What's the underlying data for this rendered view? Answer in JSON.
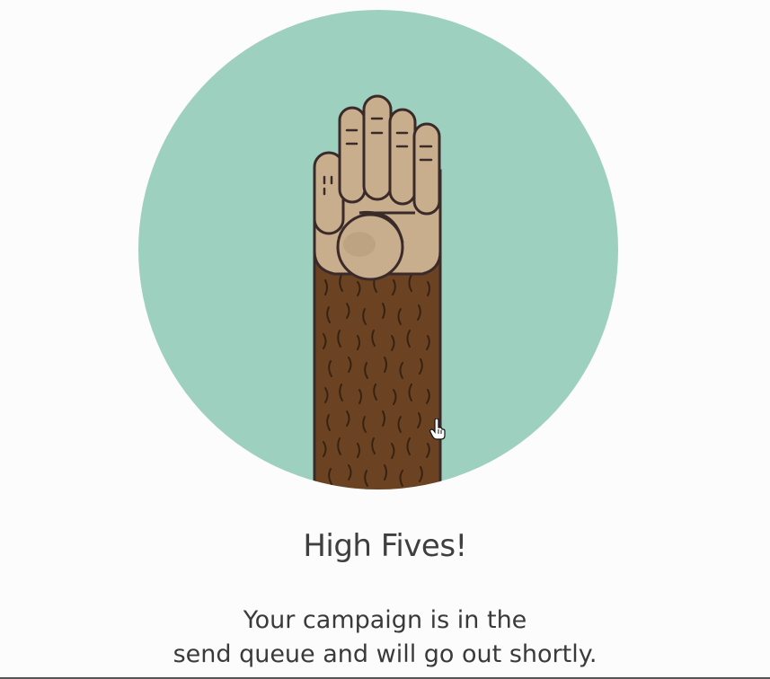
{
  "modal": {
    "headline": "High Fives!",
    "message_line_1": "Your campaign is in the",
    "message_line_2": "send queue and will go out shortly."
  },
  "illustration": {
    "icon": "high-five-hand-icon",
    "circle_color": "#9dd0bf",
    "skin_color": "#c8ae8c",
    "fur_color": "#6b4323",
    "outline_color": "#3a2a2a"
  },
  "cursor": {
    "icon": "hand-pointer-icon"
  }
}
